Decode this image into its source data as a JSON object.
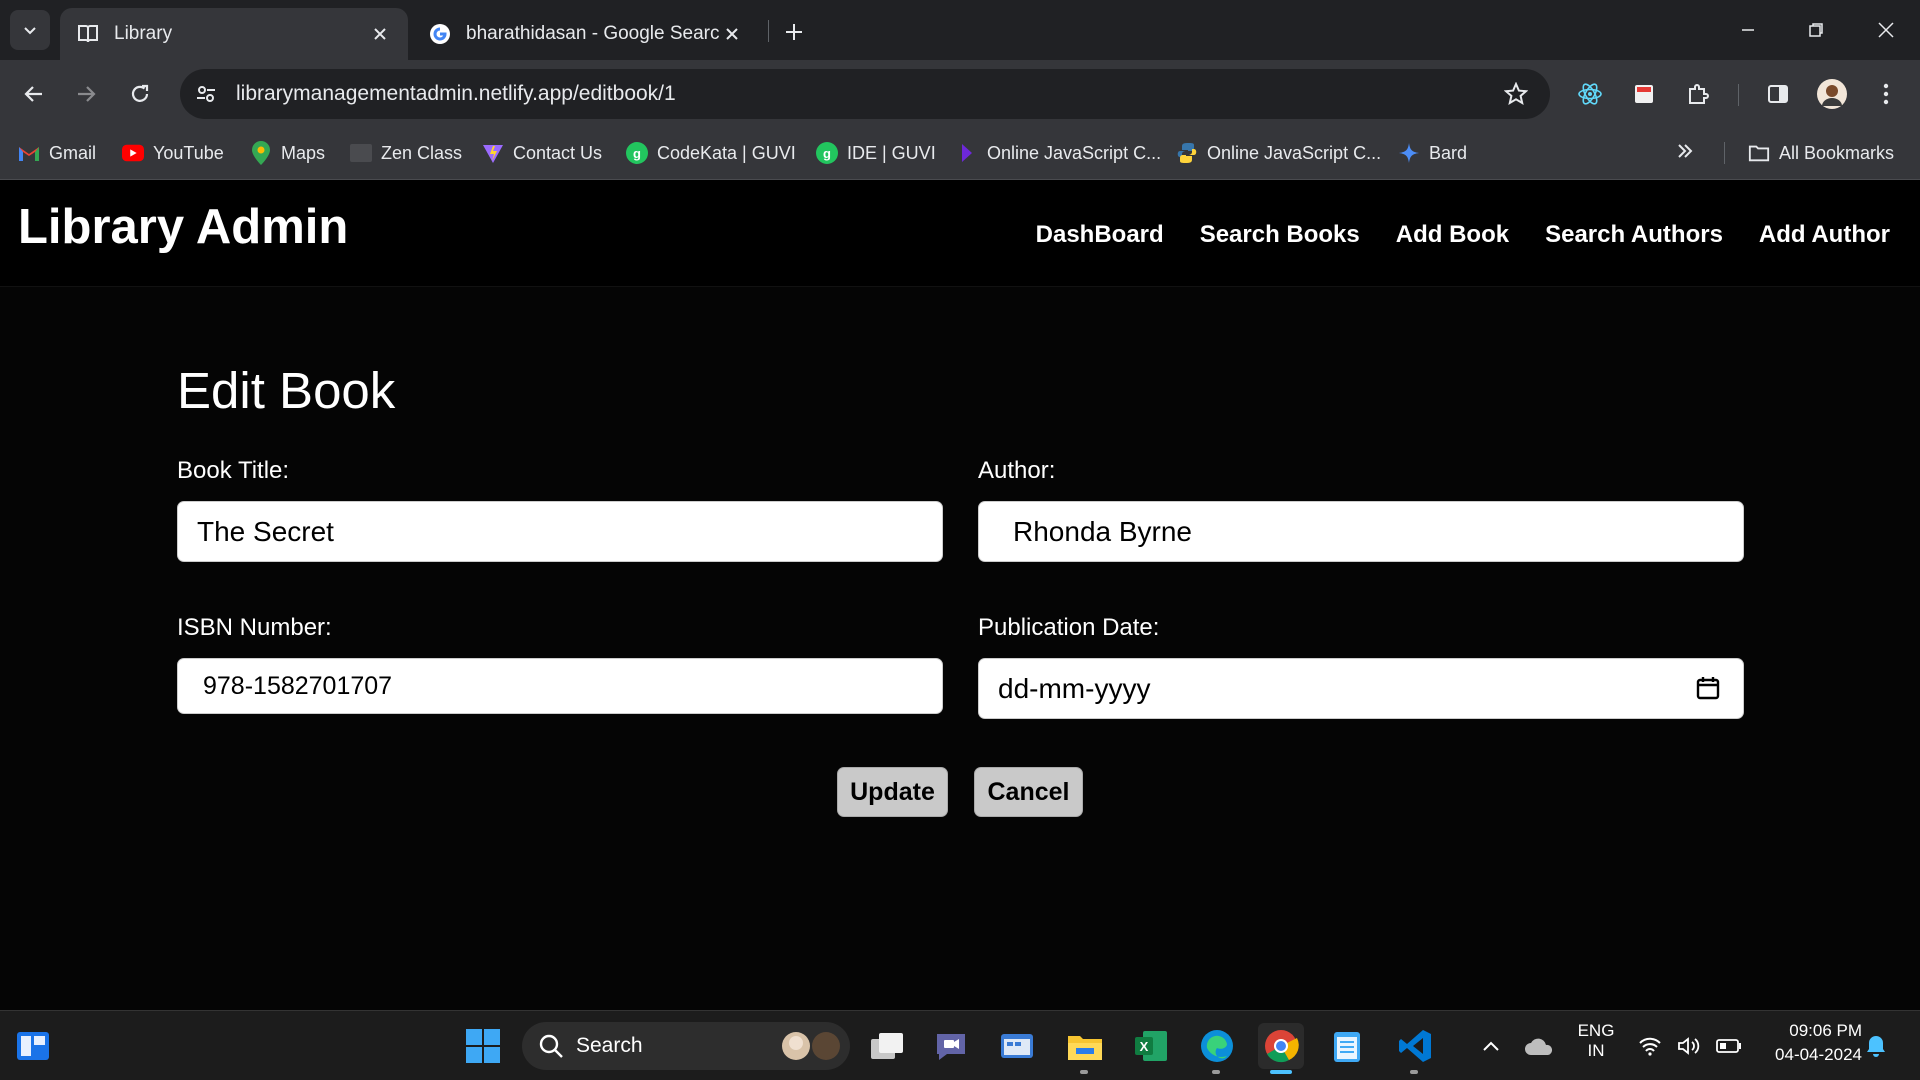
{
  "browser": {
    "tabs": [
      {
        "title": "Library",
        "active": true,
        "icon": "book-icon"
      },
      {
        "title": "bharathidasan - Google Search",
        "active": false,
        "icon": "google-icon"
      }
    ],
    "url": "librarymanagementadmin.netlify.app/editbook/1",
    "bookmarks": [
      {
        "label": "Gmail",
        "icon": "gmail-icon"
      },
      {
        "label": "YouTube",
        "icon": "youtube-icon"
      },
      {
        "label": "Maps",
        "icon": "maps-icon"
      },
      {
        "label": "Zen Class",
        "icon": "zen-icon"
      },
      {
        "label": "Contact Us",
        "icon": "vite-icon"
      },
      {
        "label": "CodeKata | GUVI",
        "icon": "guvi-icon"
      },
      {
        "label": "IDE | GUVI",
        "icon": "guvi-icon"
      },
      {
        "label": "Online JavaScript C...",
        "icon": "js-icon"
      },
      {
        "label": "Online JavaScript C...",
        "icon": "python-icon"
      },
      {
        "label": "Bard",
        "icon": "bard-icon"
      }
    ],
    "all_bookmarks": "All Bookmarks"
  },
  "app": {
    "brand": "Library Admin",
    "nav": [
      "DashBoard",
      "Search Books",
      "Add Book",
      "Search Authors",
      "Add Author"
    ],
    "form": {
      "heading": "Edit Book",
      "book_title_label": "Book Title:",
      "book_title_value": "The Secret",
      "author_label": "Author:",
      "author_value": "Rhonda Byrne",
      "isbn_label": "ISBN Number:",
      "isbn_value": "978-1582701707",
      "pubdate_label": "Publication Date:",
      "pubdate_placeholder": "dd-mm-yyyy",
      "update_label": "Update",
      "cancel_label": "Cancel"
    }
  },
  "taskbar": {
    "search_label": "Search",
    "lang_top": "ENG",
    "lang_bottom": "IN",
    "time": "09:06 PM",
    "date": "04-04-2024"
  },
  "colors": {
    "chrome_dark": "#202124",
    "chrome_toolbar": "#35363a",
    "page_bg": "#000000",
    "button_bg": "#c9c9c9"
  }
}
